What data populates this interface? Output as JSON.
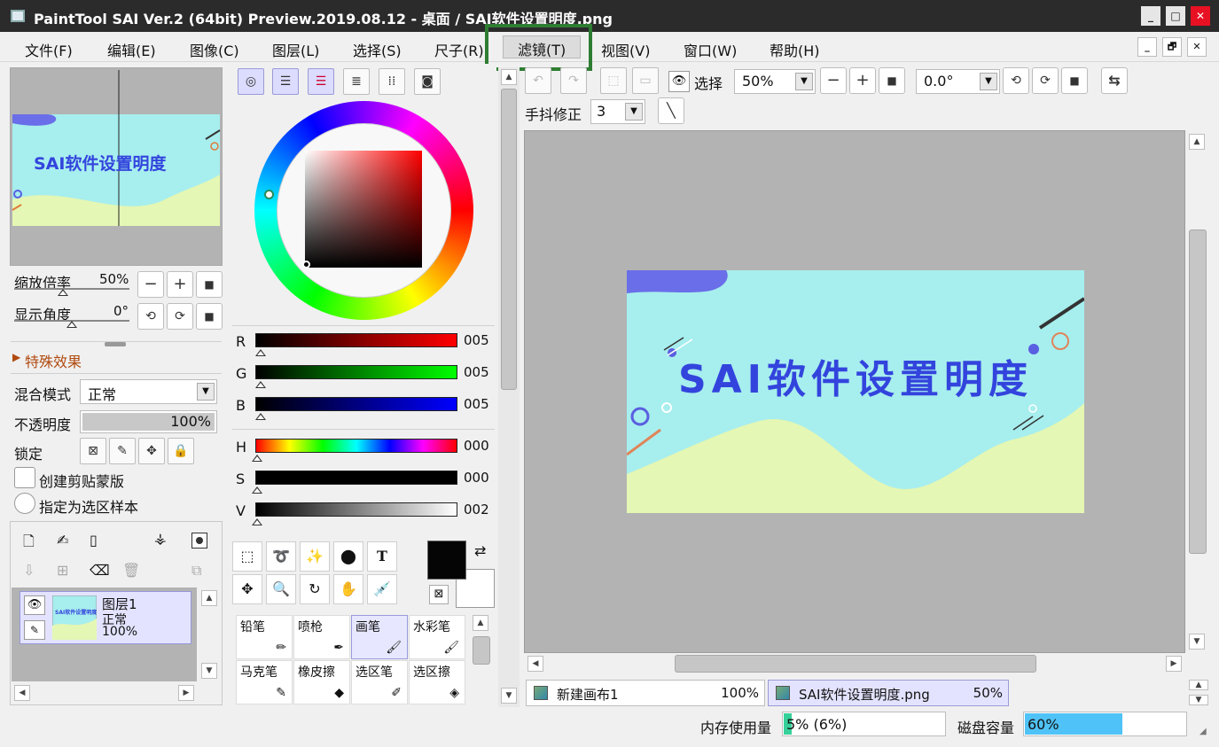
{
  "window": {
    "title": "PaintTool SAI Ver.2 (64bit) Preview.2019.08.12 - 桌面 / SAI软件设置明度.png",
    "controls": {
      "minimize": "_",
      "maximize": "□",
      "close": "✕"
    }
  },
  "menu": {
    "items": [
      "文件(F)",
      "编辑(E)",
      "图像(C)",
      "图层(L)",
      "选择(S)",
      "尺子(R)",
      "滤镜(T)",
      "视图(V)",
      "窗口(W)",
      "帮助(H)"
    ],
    "active_index": 6,
    "mdi_controls": [
      "_",
      "🗗",
      "✕"
    ]
  },
  "navigator": {
    "preview_text": "SAI软件设置明度",
    "zoom_label": "缩放倍率",
    "zoom_value": "50%",
    "angle_label": "显示角度",
    "angle_value": "0°",
    "zoom_fraction": 0.5,
    "angle_fraction": 0.5
  },
  "layer_props": {
    "effects_label": "特殊效果",
    "blend_label": "混合模式",
    "blend_value": "正常",
    "opacity_label": "不透明度",
    "opacity_value": "100%",
    "lock_label": "锁定",
    "clip_label": "创建剪贴蒙版",
    "sample_label": "指定为选区样本"
  },
  "layers": [
    {
      "name": "图层1",
      "mode": "正常",
      "opacity": "100%",
      "thumb_text": "SAI软件设置明度"
    }
  ],
  "color": {
    "rgb": [
      {
        "label": "R",
        "value": "005"
      },
      {
        "label": "G",
        "value": "005"
      },
      {
        "label": "B",
        "value": "005"
      }
    ],
    "hsv": [
      {
        "label": "H",
        "value": "000"
      },
      {
        "label": "S",
        "value": "000"
      },
      {
        "label": "V",
        "value": "002"
      }
    ],
    "foreground": "#050505",
    "background": "#ffffff"
  },
  "brushes": [
    {
      "name": "铅笔",
      "icon": "pencil-icon"
    },
    {
      "name": "喷枪",
      "icon": "airbrush-icon"
    },
    {
      "name": "画笔",
      "icon": "brush-icon",
      "selected": true
    },
    {
      "name": "水彩笔",
      "icon": "watercolor-icon"
    },
    {
      "name": "马克笔",
      "icon": "marker-icon"
    },
    {
      "name": "橡皮擦",
      "icon": "eraser-icon"
    },
    {
      "name": "选区笔",
      "icon": "selection-pen-icon"
    },
    {
      "name": "选区擦",
      "icon": "selection-eraser-icon"
    }
  ],
  "toolbar": {
    "view_label": "选择",
    "zoom": "50%",
    "rotation": "0.0°",
    "stabilizer_label": "手抖修正",
    "stabilizer": "3"
  },
  "canvas": {
    "title_text": "SAI软件设置明度",
    "colors": {
      "bg": "#a7eeee",
      "wave": "#e4f7b4",
      "text": "#3344dd",
      "blob": "#6a6ee8"
    }
  },
  "tabs": [
    {
      "name": "新建画布1",
      "zoom": "100%"
    },
    {
      "name": "SAI软件设置明度.png",
      "zoom": "50%",
      "active": true
    }
  ],
  "status": {
    "memory_label": "内存使用量",
    "memory_value": "5% (6%)",
    "memory_fraction": 0.05,
    "disk_label": "磁盘容量",
    "disk_value": "60%",
    "disk_fraction": 0.6
  }
}
